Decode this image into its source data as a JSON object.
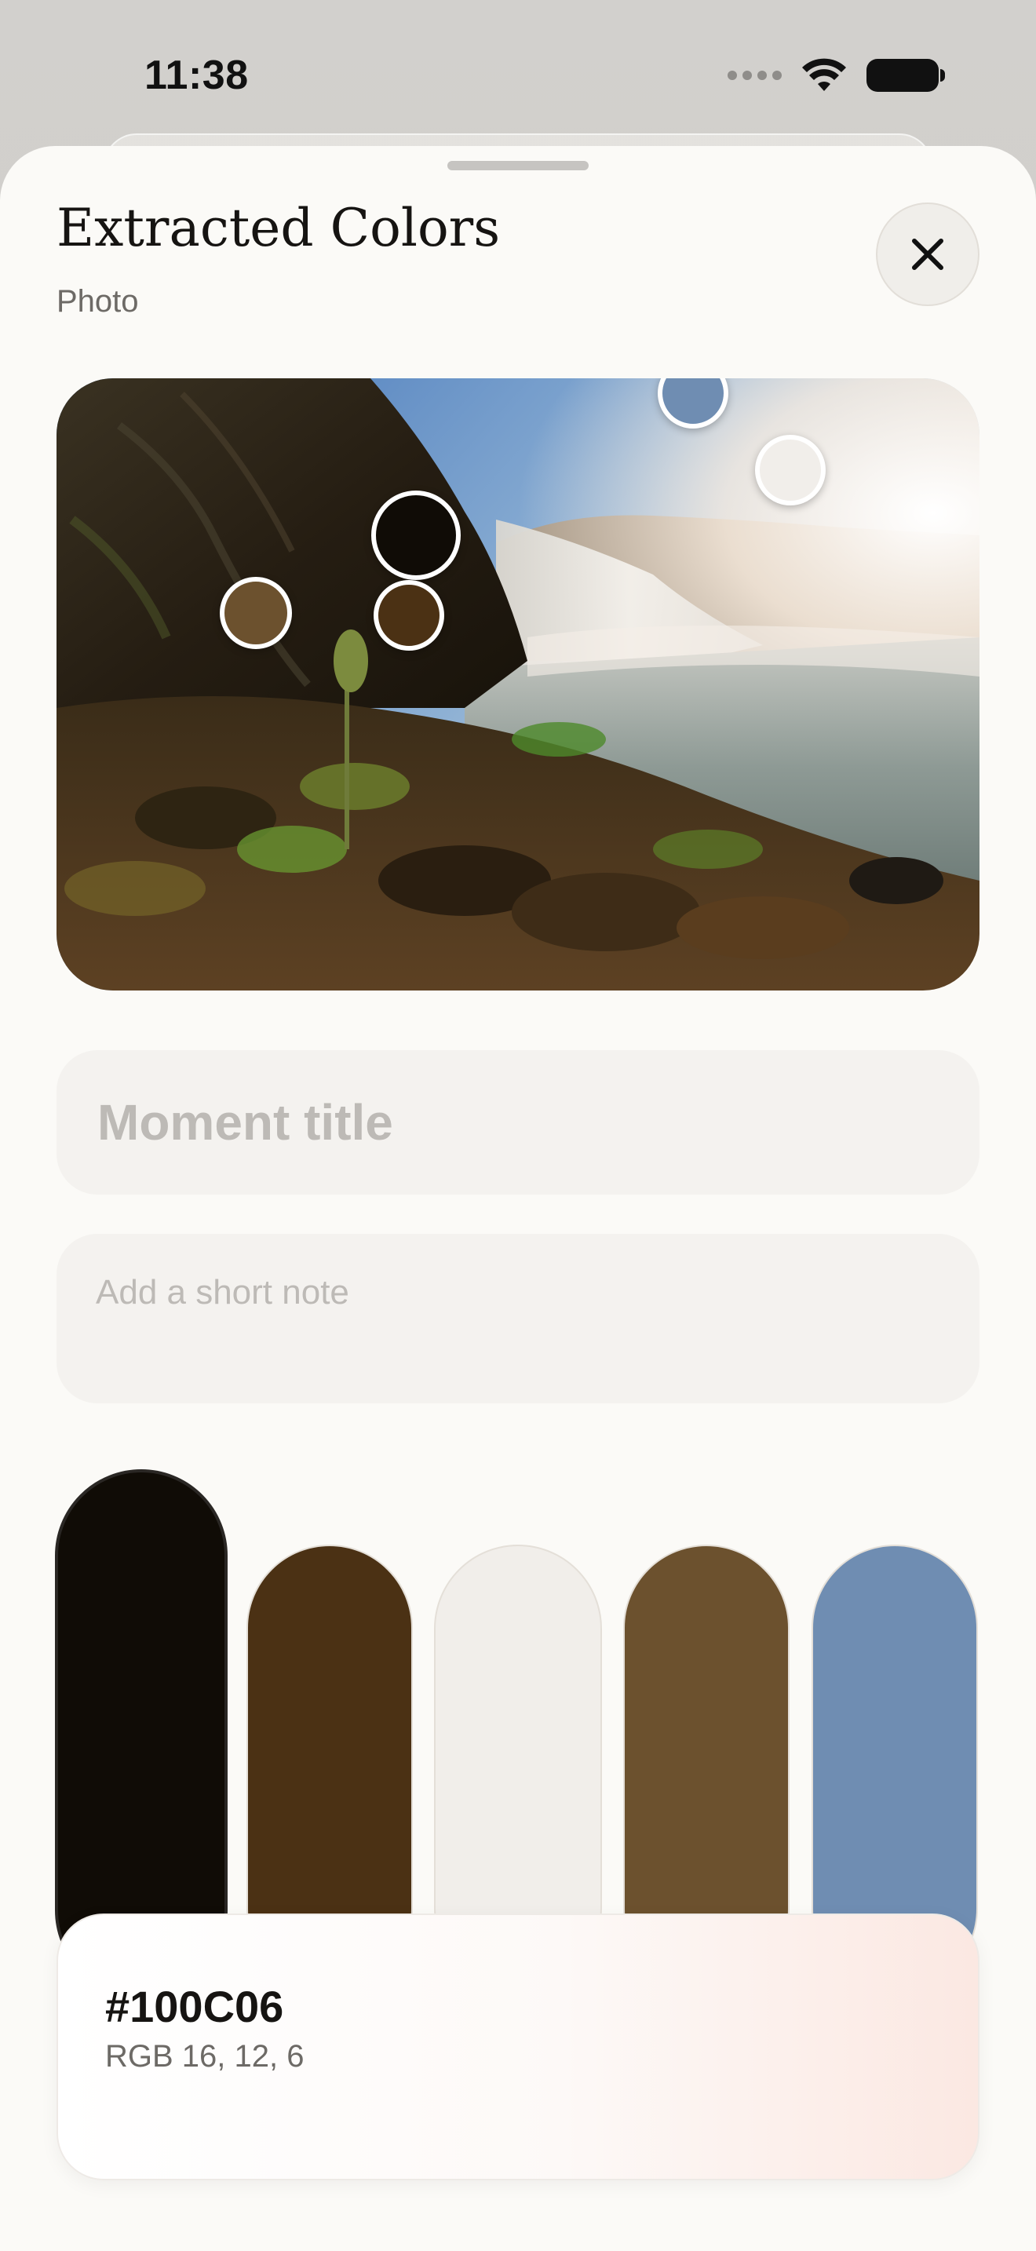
{
  "status_bar": {
    "time": "11:38"
  },
  "sheet": {
    "title": "Extracted Colors",
    "subtitle": "Photo",
    "close_icon": "close-icon"
  },
  "photo": {
    "description_icon": "photo",
    "sample_points": [
      {
        "name": "sample-dark",
        "color": "#100C06"
      },
      {
        "name": "sample-brown-dark",
        "color": "#4B3114"
      },
      {
        "name": "sample-light",
        "color": "#F1EEEA"
      },
      {
        "name": "sample-brown",
        "color": "#6C512E"
      },
      {
        "name": "sample-blue",
        "color": "#6F8DB2"
      }
    ]
  },
  "form": {
    "title_placeholder": "Moment title",
    "note_placeholder": "Add a short note"
  },
  "palette": {
    "selected_index": 0,
    "swatches": [
      {
        "hex": "#100C06"
      },
      {
        "hex": "#4B3114"
      },
      {
        "hex": "#F1EEEA"
      },
      {
        "hex": "#6C512E"
      },
      {
        "hex": "#6F8DB2"
      }
    ]
  },
  "selected_color": {
    "hex": "#100C06",
    "rgb": "RGB 16, 12, 6"
  }
}
